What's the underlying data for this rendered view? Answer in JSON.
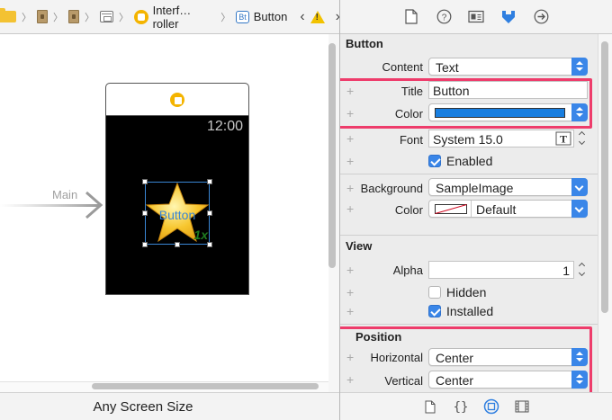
{
  "jumpbar": {
    "crumbs": [
      "Interf…roller",
      "Button"
    ],
    "button_badge": "Bt"
  },
  "canvas": {
    "entry_label": "Main",
    "scene_time": "12:00",
    "button_title": "Button",
    "button_scale": "1x",
    "size_class": "Any Screen Size"
  },
  "inspector": {
    "sections": {
      "button": "Button",
      "view": "View",
      "position": "Position"
    },
    "content": {
      "label": "Content",
      "value": "Text"
    },
    "title": {
      "label": "Title",
      "value": "Button"
    },
    "color": {
      "label": "Color",
      "value_hex": "#1a7fe0"
    },
    "font": {
      "label": "Font",
      "value": "System 15.0"
    },
    "enabled": {
      "label": "Enabled",
      "checked": true
    },
    "background": {
      "label": "Background",
      "value": "SampleImage"
    },
    "bg_color": {
      "label": "Color",
      "value": "Default"
    },
    "alpha": {
      "label": "Alpha",
      "value": "1"
    },
    "hidden": {
      "label": "Hidden",
      "checked": false
    },
    "installed": {
      "label": "Installed",
      "checked": true
    },
    "horizontal": {
      "label": "Horizontal",
      "value": "Center"
    },
    "vertical": {
      "label": "Vertical",
      "value": "Center"
    }
  },
  "colors": {
    "highlight": "#ee3c6b",
    "accent": "#3a86e8",
    "selection": "#3a86d4"
  }
}
